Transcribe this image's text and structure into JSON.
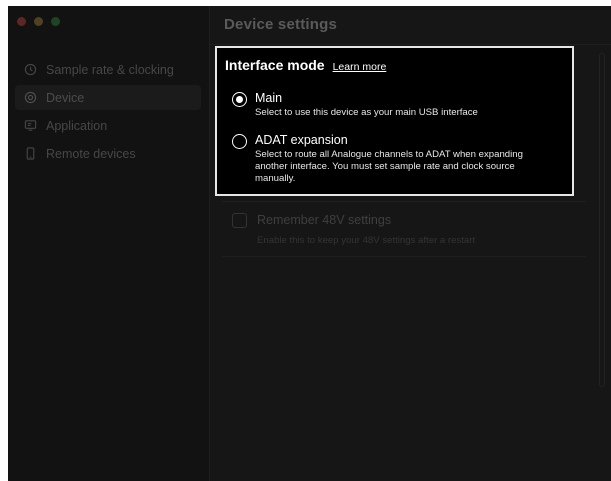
{
  "window": {
    "title": "Device settings"
  },
  "sidebar": {
    "items": [
      {
        "label": "Sample rate & clocking",
        "icon": "clock-icon"
      },
      {
        "label": "Device",
        "icon": "device-icon"
      },
      {
        "label": "Application",
        "icon": "application-icon"
      },
      {
        "label": "Remote devices",
        "icon": "phone-icon"
      }
    ],
    "active": "Device"
  },
  "interface_mode": {
    "title": "Interface mode",
    "learn_more": "Learn more",
    "options": [
      {
        "label": "Main",
        "description_lines": [
          "Select to use this device as your main USB interface"
        ],
        "selected": true
      },
      {
        "label": "ADAT expansion",
        "description_lines": [
          "Select to route all Analogue channels to ADAT when expanding",
          "another interface. You must set sample rate and clock source",
          "manually."
        ],
        "selected": false
      }
    ]
  },
  "phantom": {
    "label": "Remember 48V settings",
    "description": "Enable this to keep your 48V settings after a restart",
    "checked": false
  },
  "colors": {
    "background": "#161616",
    "sidebar": "#121212",
    "highlight_border": "#e6e6e6",
    "text_primary": "#ffffff",
    "text_dimmed": "#474747"
  }
}
